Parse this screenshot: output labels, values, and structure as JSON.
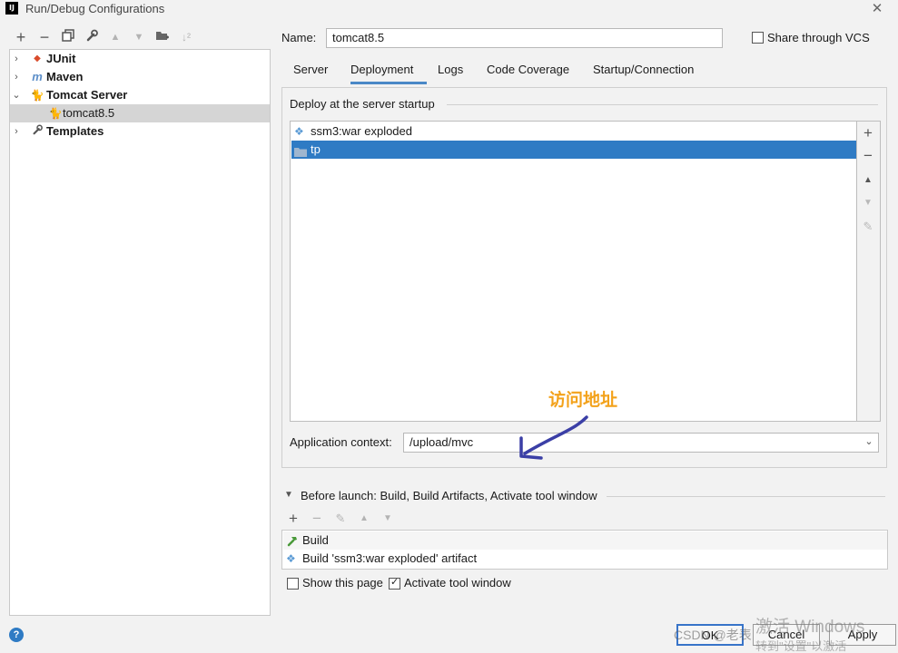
{
  "window": {
    "title": "Run/Debug Configurations",
    "app_icon_text": "IJ"
  },
  "toolbar": {
    "icons": [
      "add-icon",
      "remove-icon",
      "copy-icon",
      "wrench-icon",
      "move-up-icon",
      "move-down-icon",
      "new-folder-icon",
      "sort-icon"
    ]
  },
  "tree": {
    "items": [
      {
        "label": "JUnit",
        "icon": "junit-icon"
      },
      {
        "label": "Maven",
        "icon": "maven-icon"
      },
      {
        "label": "Tomcat Server",
        "icon": "tomcat-icon"
      },
      {
        "label": "tomcat8.5",
        "icon": "tomcat-icon"
      },
      {
        "label": "Templates",
        "icon": "wrench-icon"
      }
    ]
  },
  "config": {
    "name_label": "Name:",
    "name_value": "tomcat8.5",
    "share_label": "Share through VCS",
    "share_checked": false
  },
  "tabs": [
    "Server",
    "Deployment",
    "Logs",
    "Code Coverage",
    "Startup/Connection"
  ],
  "active_tab": "Deployment",
  "deployment": {
    "section_title": "Deploy at the server startup",
    "items": [
      {
        "label": "ssm3:war exploded",
        "icon": "artifact-icon"
      },
      {
        "label": "tp",
        "icon": "folder-icon"
      }
    ],
    "selected_index": 1,
    "side_tools": [
      "add-icon",
      "remove-icon",
      "move-up-icon",
      "move-down-icon",
      "edit-icon"
    ],
    "context_label": "Application context:",
    "context_value": "/upload/mvc"
  },
  "annotation": {
    "text": "访问地址",
    "color": "#f3a21b",
    "arrow_color": "#3b3fa6"
  },
  "before_launch": {
    "label": "Before launch: Build, Build Artifacts, Activate tool window",
    "tools": [
      "add-icon",
      "remove-icon",
      "edit-icon",
      "move-up-icon",
      "move-down-icon"
    ],
    "items": [
      {
        "label": "Build",
        "icon": "hammer-icon"
      },
      {
        "label": "Build 'ssm3:war exploded' artifact",
        "icon": "artifact-icon"
      }
    ],
    "show_page_label": "Show this page",
    "show_page_checked": false,
    "activate_label": "Activate tool window",
    "activate_checked": true
  },
  "buttons": {
    "ok": "OK",
    "cancel": "Cancel",
    "apply": "Apply"
  },
  "help": "?",
  "watermark": {
    "line1": "激活 Windows",
    "line2": "转到\"设置\"以激活 Windows。",
    "csdn": "CSDN @老表"
  },
  "colors": {
    "selection": "#2f7bc4",
    "tab_underline": "#4a88c7",
    "tree_selection": "#d5d5d5"
  }
}
